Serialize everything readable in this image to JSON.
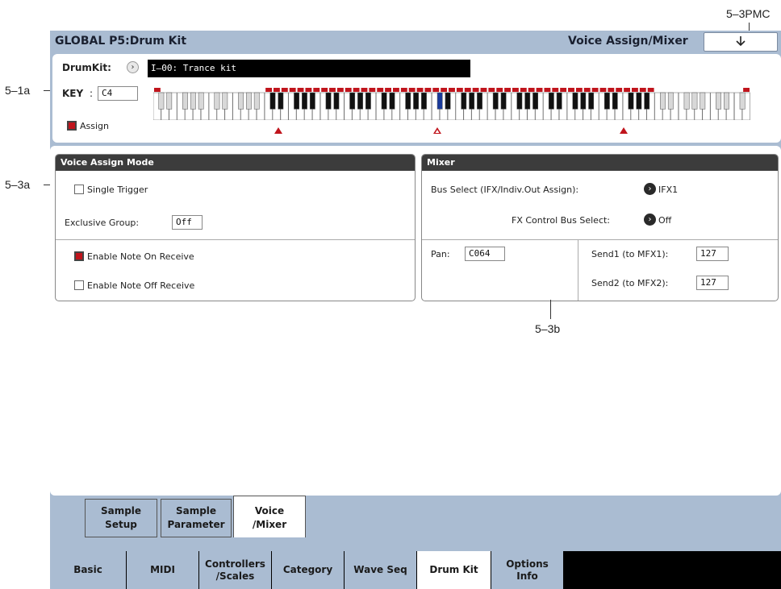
{
  "callouts": {
    "pmc": "5–3PMC",
    "key": "5–1a",
    "voice_assign": "5–3a",
    "mixer": "5–3b"
  },
  "header": {
    "title": "GLOBAL P5:Drum Kit",
    "page": "Voice Assign/Mixer",
    "menu_icon": "down-arrow-icon"
  },
  "drumkit": {
    "label": "DrumKit:",
    "value": "I–00: Trance kit"
  },
  "key": {
    "label": "KEY",
    "separator": ":",
    "value": "C4"
  },
  "assign": {
    "label": "Assign",
    "checked": true
  },
  "voice_assign_mode": {
    "header": "Voice Assign Mode",
    "single_trigger": {
      "label": "Single Trigger",
      "checked": false
    },
    "exclusive_group": {
      "label": "Exclusive Group:",
      "value": "Off"
    },
    "note_on": {
      "label": "Enable Note On Receive",
      "checked": true
    },
    "note_off": {
      "label": "Enable Note Off Receive",
      "checked": false
    }
  },
  "mixer": {
    "header": "Mixer",
    "bus_select": {
      "label": "Bus Select (IFX/Indiv.Out Assign):",
      "value": "IFX1"
    },
    "fx_control": {
      "label": "FX Control Bus Select:",
      "value": "Off"
    },
    "pan": {
      "label": "Pan:",
      "value": "C064"
    },
    "send1": {
      "label": "Send1 (to MFX1):",
      "value": "127"
    },
    "send2": {
      "label": "Send2 (to MFX2):",
      "value": "127"
    }
  },
  "sub_tabs": [
    {
      "label": "Sample\nSetup",
      "active": false
    },
    {
      "label": "Sample\nParameter",
      "active": false
    },
    {
      "label": "Voice\n/Mixer",
      "active": true
    }
  ],
  "bottom_tabs": [
    {
      "label": "Basic",
      "active": false
    },
    {
      "label": "MIDI",
      "active": false
    },
    {
      "label": "Controllers\n/Scales",
      "active": false
    },
    {
      "label": "Category",
      "active": false
    },
    {
      "label": "Wave Seq",
      "active": false
    },
    {
      "label": "Drum Kit",
      "active": true
    },
    {
      "label": "Options\nInfo",
      "active": false
    }
  ],
  "colors": {
    "accent": "#c0141c",
    "panel_bg": "#aabcd2",
    "selected_key": "#1a3a9a"
  }
}
